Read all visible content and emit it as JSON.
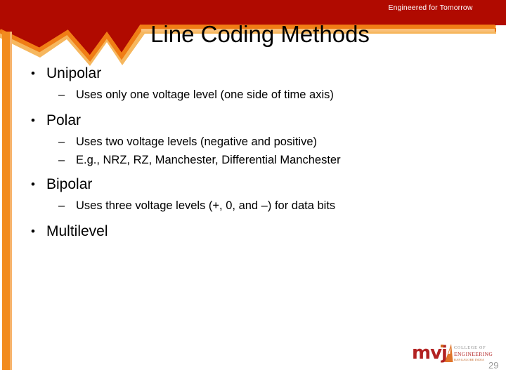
{
  "slide": {
    "title": "Line Coding Methods",
    "tagline": "Engineered for Tomorrow",
    "page_number": "29"
  },
  "colors": {
    "header_dark_red": "#b00a00",
    "accent_orange": "#f28b1e",
    "accent_orange_light": "#f6a94a",
    "logo_red": "#b22222",
    "page_number_gray": "#9a9a9a",
    "body_text": "#000000",
    "background": "#ffffff"
  },
  "content": {
    "groups": [
      {
        "heading": "Unipolar",
        "bullet_marker": "•",
        "sub_items": [
          {
            "marker": "–",
            "text": "Uses only one voltage level (one side of time axis)"
          }
        ]
      },
      {
        "heading": "Polar",
        "bullet_marker": "•",
        "sub_items": [
          {
            "marker": "–",
            "text": "Uses two voltage levels (negative and positive)"
          },
          {
            "marker": "–",
            "text": "E.g., NRZ, RZ, Manchester, Differential Manchester"
          }
        ]
      },
      {
        "heading": "Bipolar",
        "bullet_marker": "•",
        "sub_items": [
          {
            "marker": "–",
            "text": "Uses three voltage levels  (+, 0, and –) for data bits"
          }
        ]
      },
      {
        "heading": "Multilevel",
        "bullet_marker": "•",
        "sub_items": []
      }
    ]
  },
  "logo": {
    "wordmark": "mvj",
    "line1": "COLLEGE OF",
    "line2": "ENGINEERING",
    "line3": "BANGALORE INDIA"
  }
}
